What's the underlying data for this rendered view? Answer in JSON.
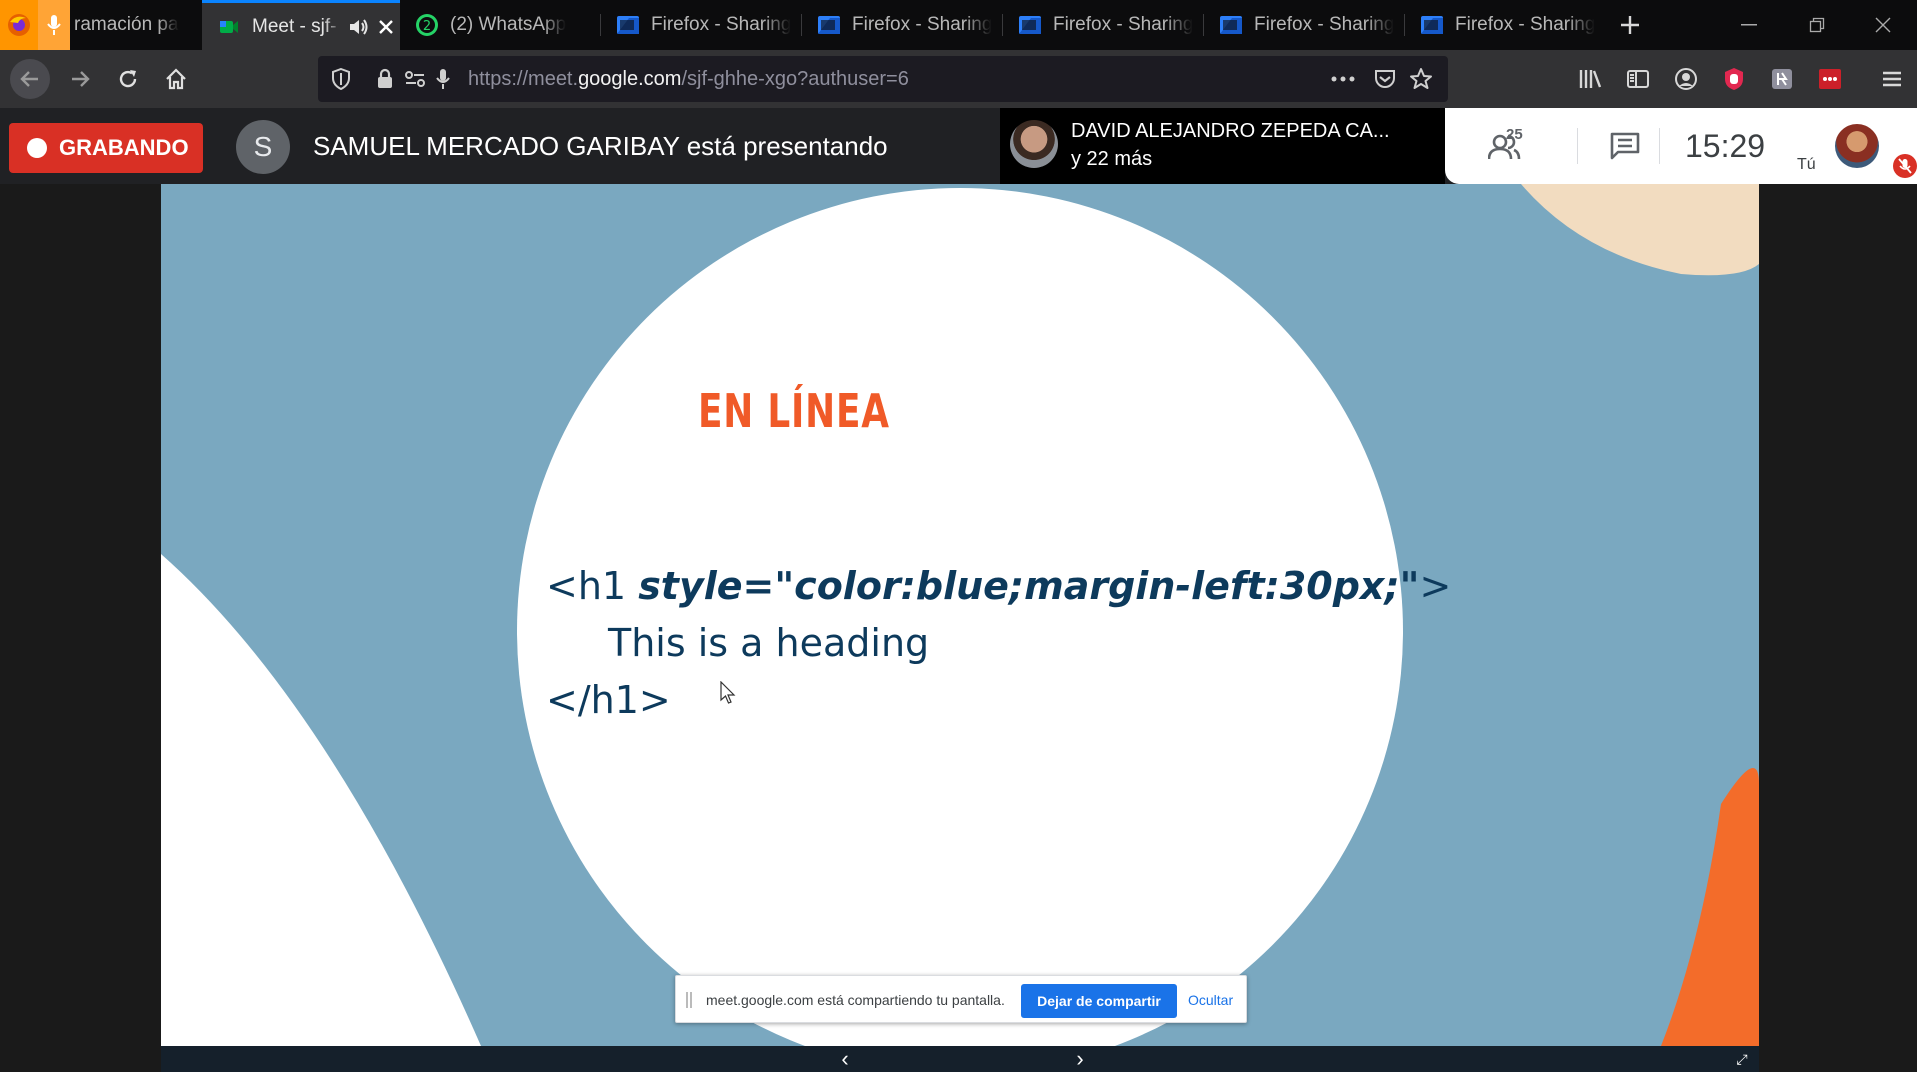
{
  "tabs": [
    {
      "label": "ramación pa",
      "kind": "firefox-mic"
    },
    {
      "label": "Meet - sjf-",
      "kind": "meet",
      "active": true
    },
    {
      "label": "(2) WhatsApp",
      "kind": "whatsapp",
      "badge": "2"
    },
    {
      "label": "Firefox - Sharing",
      "kind": "firefox-sharing"
    },
    {
      "label": "Firefox - Sharing",
      "kind": "firefox-sharing"
    },
    {
      "label": "Firefox - Sharing",
      "kind": "firefox-sharing"
    },
    {
      "label": "Firefox - Sharing",
      "kind": "firefox-sharing"
    },
    {
      "label": "Firefox - Sharing",
      "kind": "firefox-sharing"
    }
  ],
  "browser": {
    "url_prefix": "https://meet.",
    "url_domain": "google.com",
    "url_suffix": "/sjf-ghhe-xgo?authuser=6"
  },
  "meet": {
    "recording_label": "GRABANDO",
    "presenter_initial": "S",
    "presenter_text": "SAMUEL MERCADO GARIBAY está presentando",
    "participant_name": "DAVID ALEJANDRO ZEPEDA CA...",
    "participant_more": "y 22 más",
    "people_count": "25",
    "time": "15:29",
    "self_label": "Tú"
  },
  "slide": {
    "title": "EN LÍNEA",
    "code_tag_open": "<h1 ",
    "code_style_attr": "style=\"color:blue;margin-left:30px;\"",
    "code_tag_close_bracket": ">",
    "code_content": "This is a heading",
    "code_end_tag": "</h1>"
  },
  "share_bar": {
    "message": "meet.google.com está compartiendo tu pantalla.",
    "stop_label": "Dejar de compartir",
    "hide_label": "Ocultar"
  },
  "colors": {
    "recording": "#d93025",
    "accent_blue": "#1a73e8",
    "slide_background": "#7aa8c0",
    "slide_title": "#f05a28",
    "code_text": "#0d3a5c"
  }
}
